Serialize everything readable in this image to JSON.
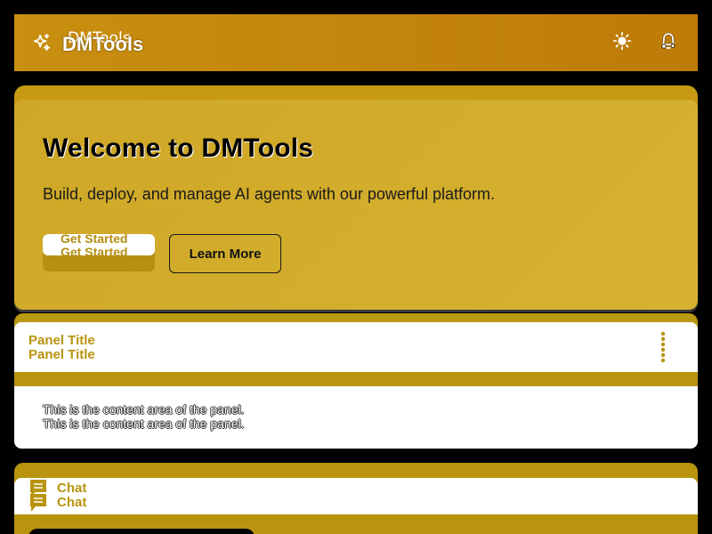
{
  "header": {
    "brand": "DMTools",
    "brand_icon": "sparkle-icon",
    "theme_icon": "sun-icon",
    "notifications_icon": "bell-icon"
  },
  "hero": {
    "title": "Welcome to DMTools",
    "subtitle": "Build, deploy, and manage AI agents with our powerful platform.",
    "primary_button": "Get Started",
    "secondary_button": "Learn More"
  },
  "panel": {
    "title": "Panel Title",
    "content": "This is the content area of the panel.",
    "menu_icon": "more-vertical-icon"
  },
  "chat": {
    "title": "Chat",
    "icon": "chat-bubble-icon"
  },
  "colors": {
    "header": "#c3850c",
    "accent": "#b8940f",
    "hero": "#d2ac2b",
    "background": "#000000"
  }
}
